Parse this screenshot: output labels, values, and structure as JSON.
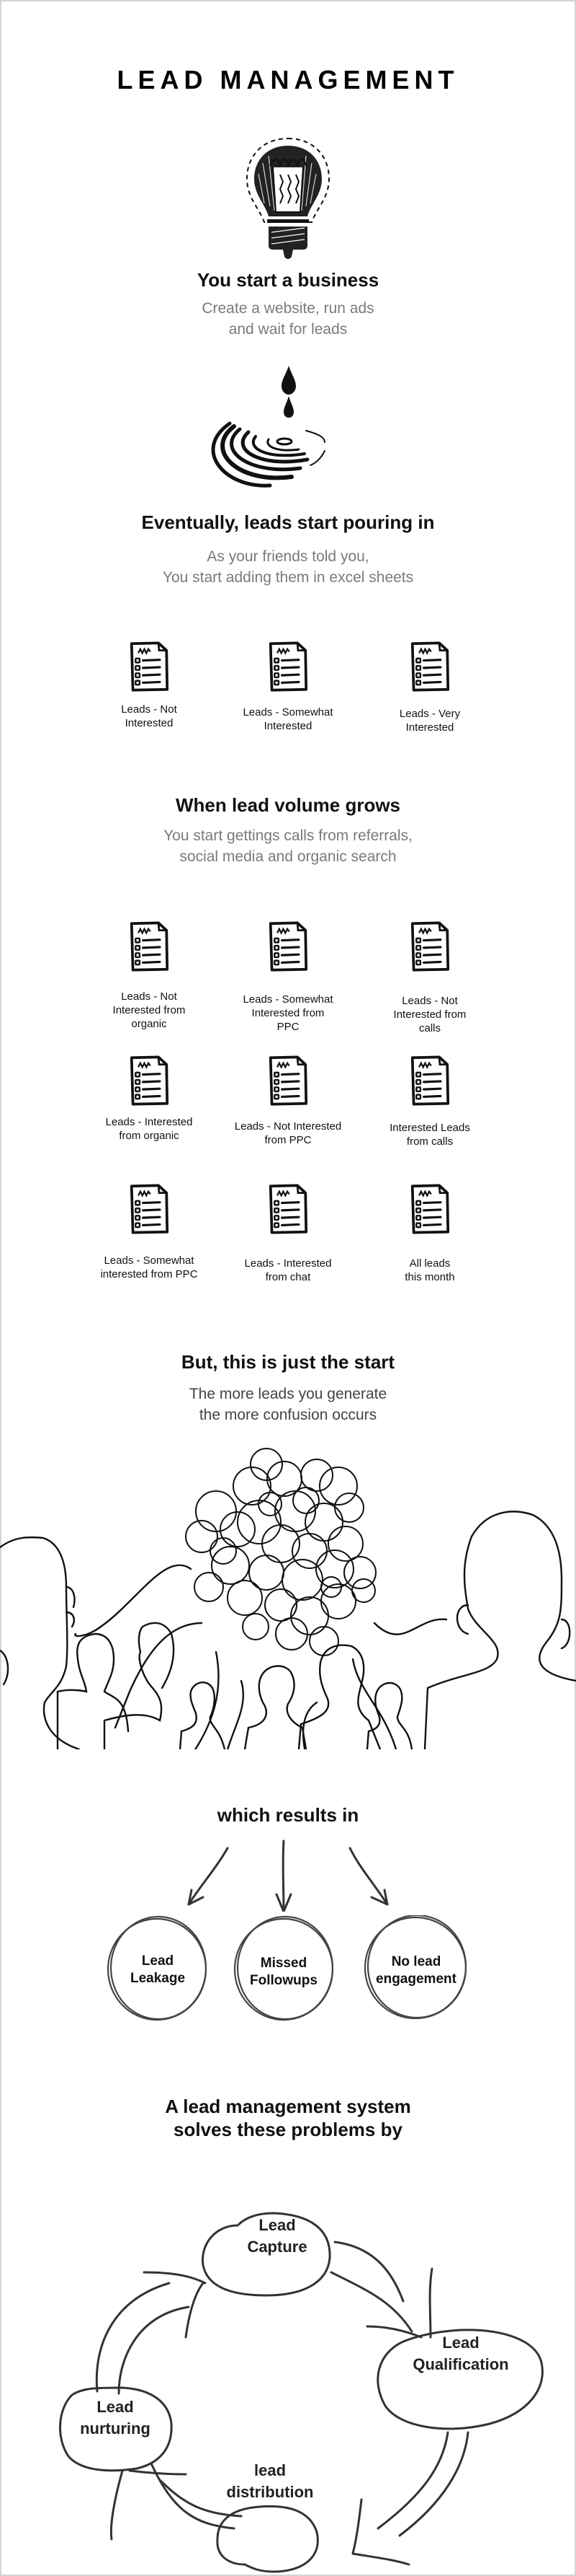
{
  "title": "LEAD MANAGEMENT",
  "sections": {
    "start": {
      "icon": "lightbulb-icon",
      "heading": "You start a business",
      "subtitle_lines": [
        "Create a website, run ads",
        "and wait for leads"
      ]
    },
    "pouring": {
      "icon": "water-drop-icon",
      "heading": "Eventually, leads start pouring in",
      "subtitle_lines": [
        "As your friends told you,",
        "You start adding them in excel sheets"
      ]
    },
    "sheets_initial": {
      "icon": "document-list-icon",
      "items": [
        {
          "label_lines": [
            "Leads - Not",
            "Interested"
          ]
        },
        {
          "label_lines": [
            "Leads - Somewhat",
            "Interested"
          ]
        },
        {
          "label_lines": [
            "Leads - Very",
            "Interested"
          ]
        }
      ]
    },
    "growth": {
      "heading": "When lead volume grows",
      "subtitle_lines": [
        "You start gettings calls from referrals,",
        "social media and organic search"
      ]
    },
    "sheets_growth": {
      "icon": "document-list-icon",
      "rows": [
        [
          {
            "label_lines": [
              "Leads - Not",
              "Interested from",
              "organic"
            ]
          },
          {
            "label_lines": [
              "Leads - Somewhat",
              "Interested from",
              "PPC"
            ]
          },
          {
            "label_lines": [
              "Leads - Not",
              "Interested from",
              "calls"
            ]
          }
        ],
        [
          {
            "label_lines": [
              "Leads - Interested",
              "from organic"
            ]
          },
          {
            "label_lines": [
              "Leads - Not Interested",
              "from PPC"
            ]
          },
          {
            "label_lines": [
              "Interested Leads",
              "from calls"
            ]
          }
        ],
        [
          {
            "label_lines": [
              "Leads - Somewhat",
              "interested from PPC"
            ]
          },
          {
            "label_lines": [
              "Leads - Interested",
              "from chat"
            ]
          },
          {
            "label_lines": [
              "All leads",
              "this month"
            ]
          }
        ]
      ]
    },
    "confusion": {
      "heading": "But, this is just the start",
      "subtitle_lines": [
        "The more leads you generate",
        "the more confusion occurs"
      ],
      "illustration": "tangled-heads-illustration"
    },
    "results": {
      "heading": "which results in",
      "items": [
        {
          "label_lines": [
            "Lead",
            "Leakage"
          ]
        },
        {
          "label_lines": [
            "Missed",
            "Followups"
          ]
        },
        {
          "label_lines": [
            "No lead",
            "engagement"
          ]
        }
      ]
    },
    "solution": {
      "heading_lines": [
        "A lead management system",
        "solves these problems by"
      ],
      "cycle": [
        {
          "label_lines": [
            "Lead",
            "Capture"
          ]
        },
        {
          "label_lines": [
            "Lead",
            "Qualification"
          ]
        },
        {
          "label_lines": [
            "lead",
            "distribution"
          ]
        },
        {
          "label_lines": [
            "Lead",
            "nurturing"
          ]
        }
      ]
    }
  },
  "colors": {
    "ink": "#111111",
    "muted_text": "#7a7a7a",
    "dark_muted_text": "#444444",
    "frame": "#d4d4d4"
  }
}
